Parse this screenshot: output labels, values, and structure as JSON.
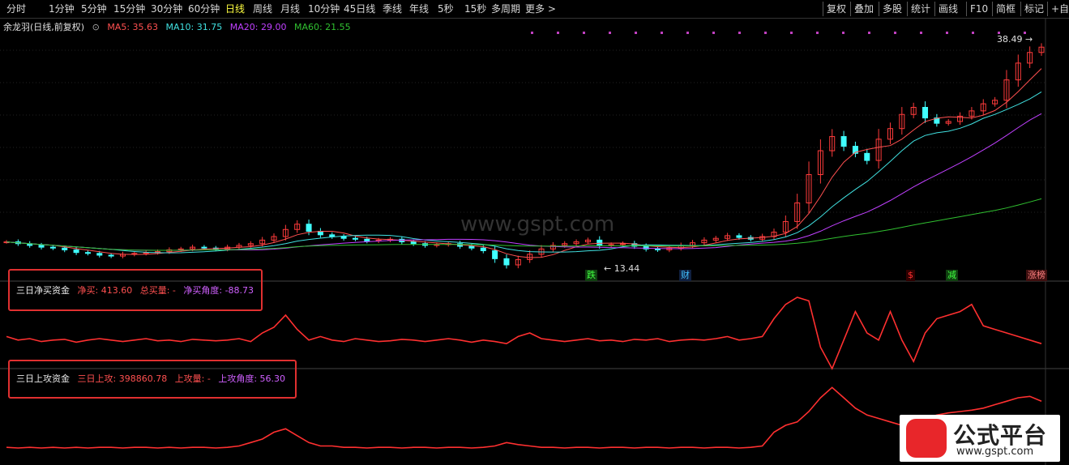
{
  "toolbar": {
    "periods": [
      "分时",
      "1分钟",
      "5分钟",
      "15分钟",
      "30分钟",
      "60分钟",
      "日线",
      "周线",
      "月线",
      "10分钟",
      "45日线",
      "季线",
      "年线",
      "5秒",
      "15秒",
      "多周期",
      "更多 >"
    ],
    "active_period": "日线",
    "right_buttons": [
      "复权",
      "叠加",
      "多股",
      "统计",
      "画线",
      "F10",
      "简框",
      "标记",
      "+自"
    ]
  },
  "stock": {
    "name": "余龙羽(日线,前复权)",
    "ma5_label": "MA5: 35.63",
    "ma10_label": "MA10: 31.75",
    "ma20_label": "MA20: 29.00",
    "ma60_label": "MA60: 21.55",
    "high_label": "38.49",
    "low_label": "13.44",
    "colors": {
      "up": "#ff3b3b",
      "down": "#40ffff",
      "ma5": "#ff5050",
      "ma10": "#40e0e0",
      "ma20": "#c040ff",
      "ma60": "#30c030"
    }
  },
  "markers": [
    {
      "text": "跌",
      "color": "#40ff40",
      "bg": "#104010"
    },
    {
      "text": "财",
      "color": "#40c0ff",
      "bg": "#102040"
    },
    {
      "text": "$",
      "color": "#ff3030",
      "bg": "#300000"
    },
    {
      "text": "减",
      "color": "#40ff40",
      "bg": "#104010"
    },
    {
      "text": "涨榜",
      "color": "#ff8080",
      "bg": "#401010"
    }
  ],
  "indicator1": {
    "title": "三日净买资金",
    "net_buy": "净买: 413.60",
    "total_buy": "总买量: -",
    "angle": "净买角度: -88.73"
  },
  "indicator2": {
    "title": "三日上攻资金",
    "attack": "三日上攻: 398860.78",
    "attack_vol": "上攻量: -",
    "angle": "上攻角度: 56.30"
  },
  "watermark": {
    "site": "www.gspt.com",
    "logo_title": "公式平台",
    "logo_url": "www.gspt.com"
  },
  "chart_data": {
    "type": "candlestick",
    "prices": [
      16.2,
      16.0,
      15.8,
      15.6,
      15.5,
      15.3,
      15.0,
      14.9,
      14.7,
      14.6,
      14.8,
      14.9,
      15.0,
      15.1,
      15.3,
      15.4,
      15.6,
      15.5,
      15.4,
      15.6,
      15.8,
      16.0,
      16.4,
      16.8,
      17.6,
      18.2,
      17.4,
      17.0,
      16.8,
      16.6,
      16.5,
      16.3,
      16.4,
      16.5,
      16.2,
      16.0,
      15.8,
      15.9,
      16.0,
      15.7,
      15.5,
      15.2,
      14.3,
      13.6,
      14.2,
      14.8,
      15.4,
      15.8,
      16.0,
      16.2,
      16.4,
      15.8,
      15.9,
      16.0,
      15.7,
      15.4,
      15.3,
      15.5,
      15.8,
      16.1,
      16.4,
      16.6,
      16.9,
      16.7,
      16.5,
      16.8,
      17.3,
      18.5,
      20.6,
      23.8,
      26.5,
      28.1,
      27.0,
      26.2,
      25.4,
      27.8,
      29.0,
      30.6,
      31.4,
      30.2,
      29.6,
      29.8,
      30.4,
      31.0,
      31.8,
      32.2,
      34.5,
      36.4,
      37.6,
      38.2
    ],
    "y_range": [
      12.5,
      39.5
    ],
    "ind1": [
      0.55,
      0.6,
      0.58,
      0.62,
      0.6,
      0.59,
      0.63,
      0.6,
      0.58,
      0.6,
      0.62,
      0.6,
      0.58,
      0.61,
      0.6,
      0.62,
      0.59,
      0.6,
      0.61,
      0.6,
      0.58,
      0.62,
      0.5,
      0.42,
      0.25,
      0.45,
      0.6,
      0.55,
      0.6,
      0.62,
      0.58,
      0.6,
      0.62,
      0.61,
      0.59,
      0.6,
      0.62,
      0.6,
      0.58,
      0.6,
      0.63,
      0.6,
      0.62,
      0.65,
      0.55,
      0.5,
      0.58,
      0.6,
      0.62,
      0.6,
      0.58,
      0.61,
      0.6,
      0.62,
      0.59,
      0.6,
      0.58,
      0.62,
      0.6,
      0.59,
      0.6,
      0.58,
      0.55,
      0.6,
      0.58,
      0.55,
      0.3,
      0.1,
      0.0,
      0.05,
      0.7,
      1.0,
      0.6,
      0.2,
      0.5,
      0.6,
      0.2,
      0.6,
      0.9,
      0.5,
      0.3,
      0.25,
      0.2,
      0.1,
      0.4,
      0.45,
      0.5,
      0.55,
      0.6,
      0.65
    ],
    "ind2": [
      0.92,
      0.93,
      0.92,
      0.93,
      0.92,
      0.93,
      0.92,
      0.93,
      0.92,
      0.92,
      0.93,
      0.92,
      0.92,
      0.93,
      0.92,
      0.93,
      0.92,
      0.92,
      0.93,
      0.92,
      0.9,
      0.85,
      0.8,
      0.7,
      0.65,
      0.75,
      0.85,
      0.9,
      0.9,
      0.92,
      0.92,
      0.93,
      0.92,
      0.92,
      0.93,
      0.92,
      0.92,
      0.93,
      0.92,
      0.92,
      0.93,
      0.92,
      0.9,
      0.85,
      0.88,
      0.9,
      0.92,
      0.92,
      0.93,
      0.92,
      0.92,
      0.93,
      0.92,
      0.92,
      0.93,
      0.92,
      0.92,
      0.93,
      0.92,
      0.92,
      0.93,
      0.92,
      0.92,
      0.93,
      0.92,
      0.9,
      0.7,
      0.6,
      0.55,
      0.4,
      0.2,
      0.05,
      0.2,
      0.35,
      0.45,
      0.5,
      0.55,
      0.6,
      0.55,
      0.5,
      0.45,
      0.42,
      0.4,
      0.38,
      0.35,
      0.3,
      0.25,
      0.2,
      0.18,
      0.25
    ]
  }
}
